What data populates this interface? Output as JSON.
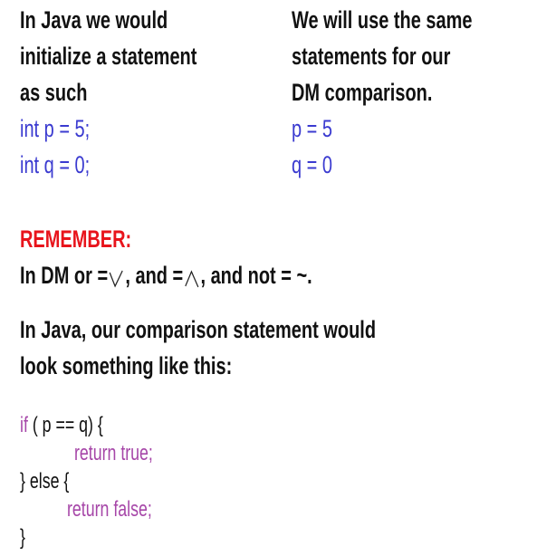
{
  "left_column": {
    "line1": "In Java we would",
    "line2": "initialize a statement",
    "line3": "as such",
    "code1": "int p = 5;",
    "code2": "int q = 0;"
  },
  "right_column": {
    "line1": "We will use the same",
    "line2": "statements for our",
    "line3": "DM comparison.",
    "code1": "p = 5",
    "code2": "q = 0"
  },
  "remember": {
    "heading": "REMEMBER:",
    "text_before": "In DM or =",
    "text_middle": ", and =",
    "text_after": ", and not = ~.",
    "or_symbol": "or-symbol-icon",
    "and_symbol": "and-symbol-icon"
  },
  "comparison": {
    "line1": "In Java, our comparison statement would",
    "line2": "look something like this:"
  },
  "code": {
    "if_kw": "if",
    "if_cond": " (  p == q) {",
    "return_true": "return true;",
    "else_line": "} else {",
    "return_false": "return false;",
    "close_brace": "}"
  },
  "colors": {
    "code_blue": "#3b3bd0",
    "remember_red": "#e8141c",
    "keyword_purple": "#a646a8"
  }
}
